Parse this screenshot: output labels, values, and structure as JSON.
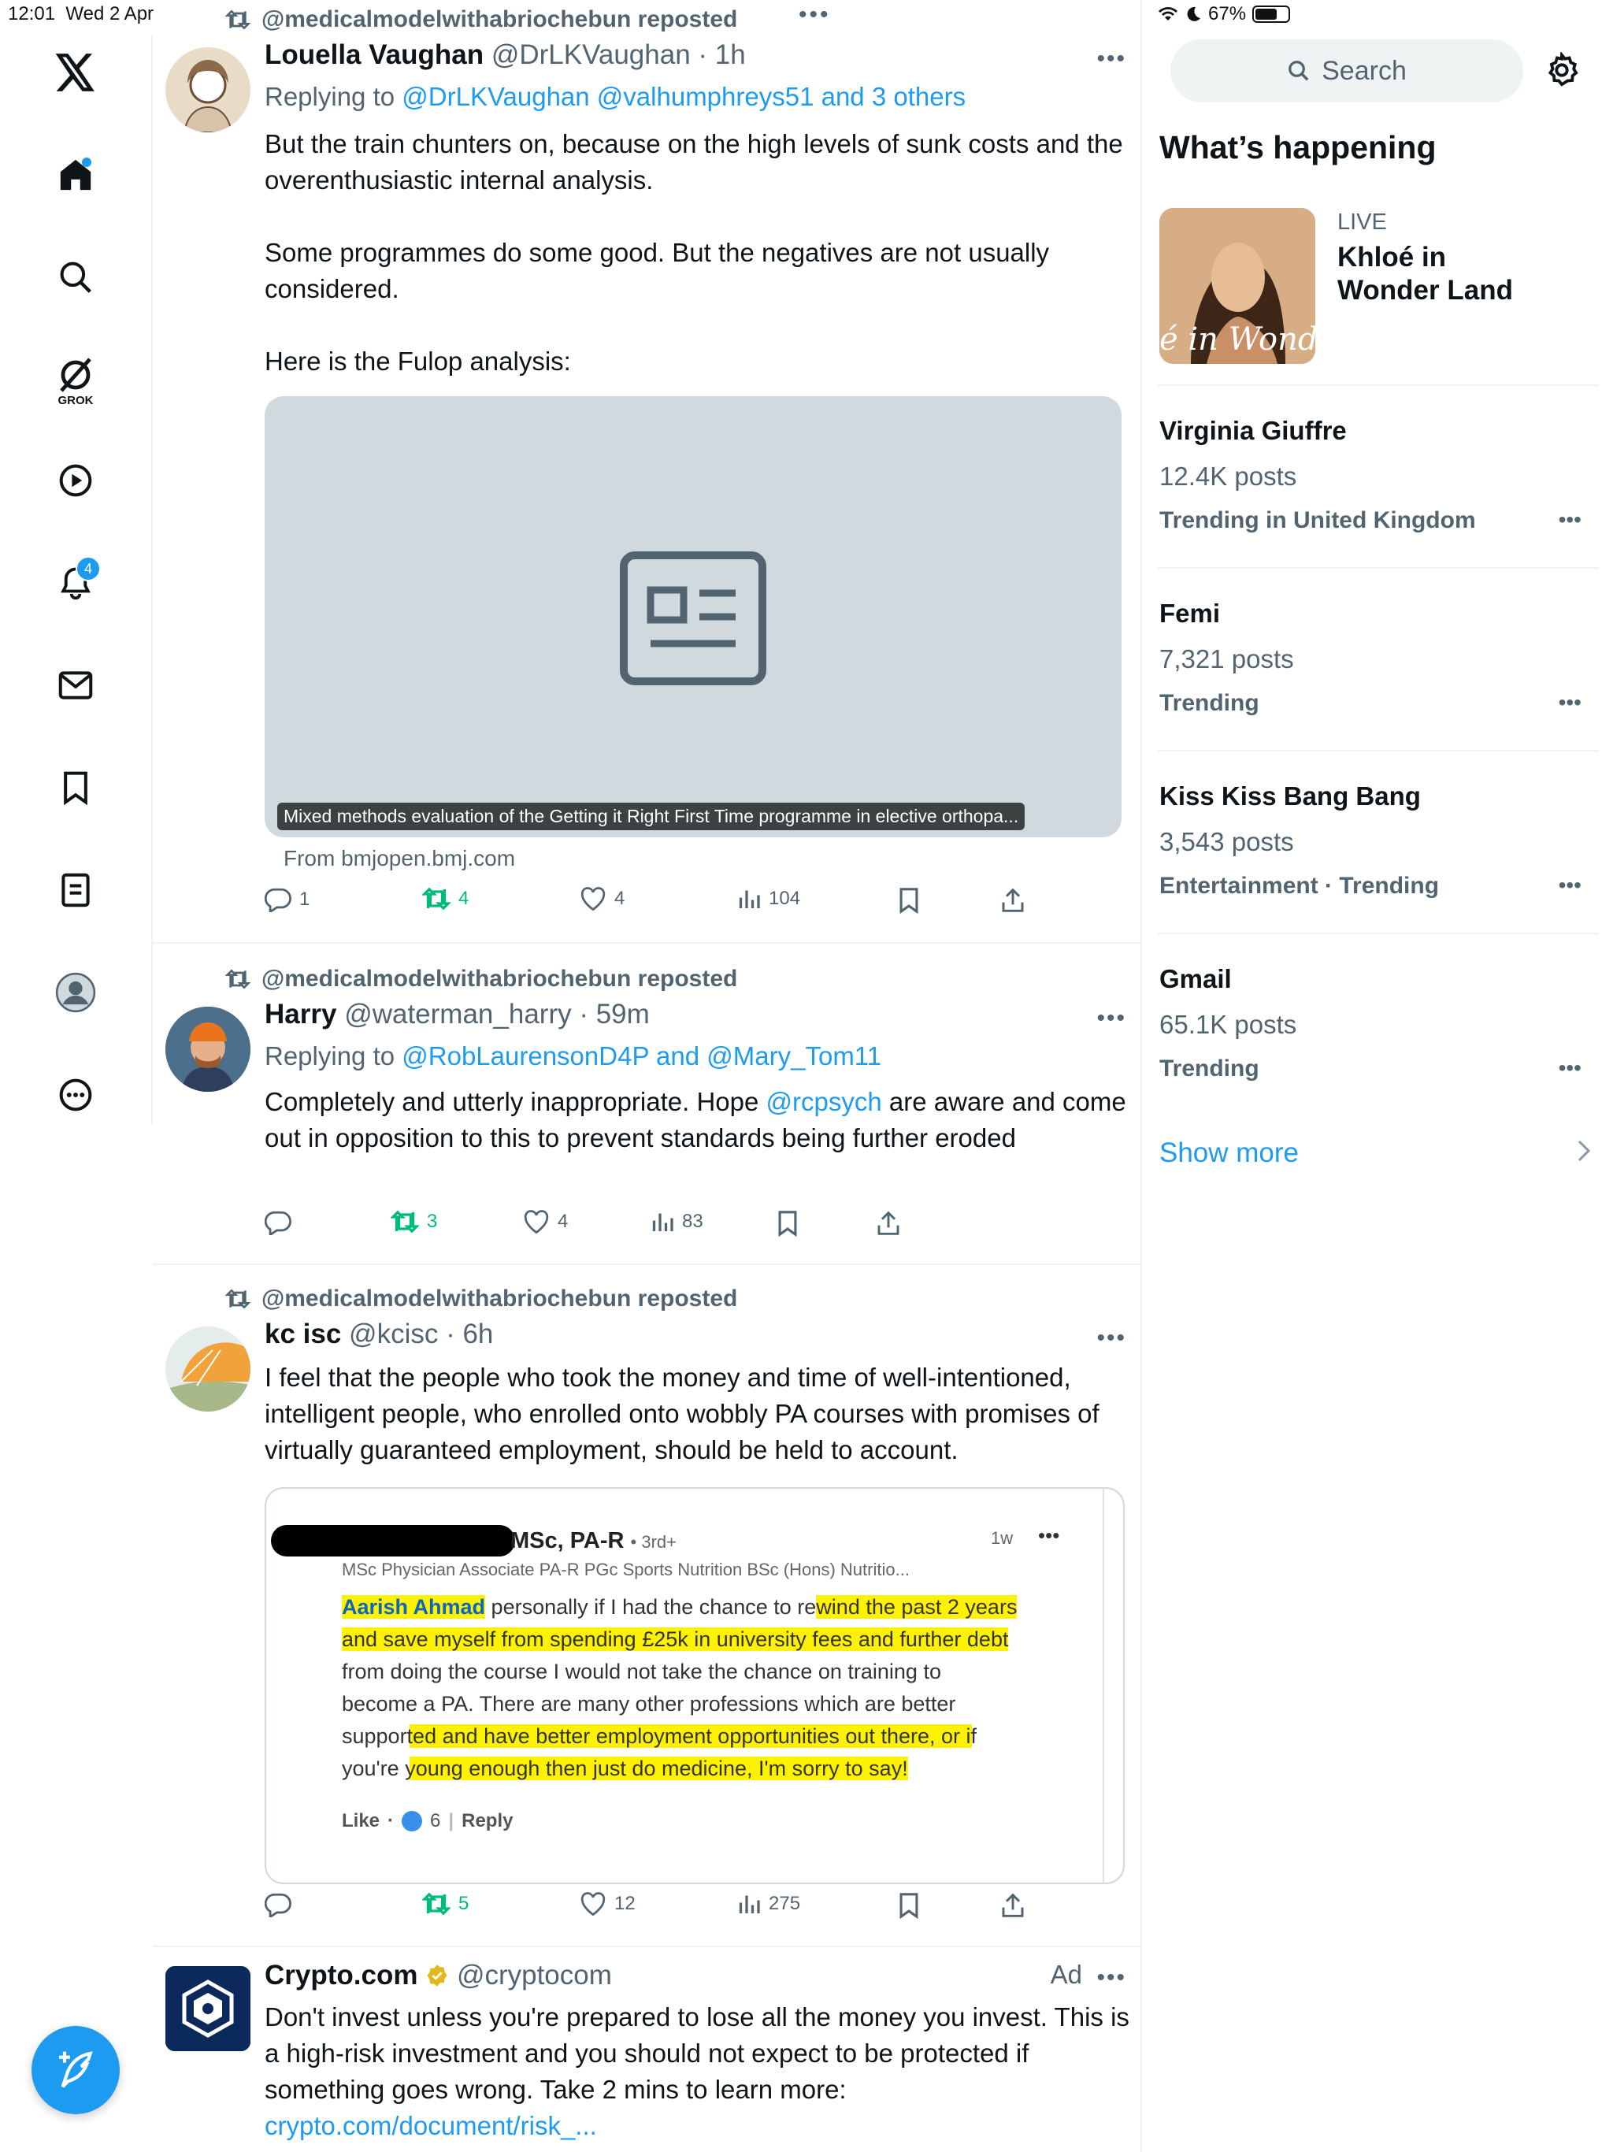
{
  "status_bar": {
    "time": "12:01",
    "date": "Wed 2 Apr",
    "battery": "67%",
    "battery_level": 0.67
  },
  "nav": {
    "notifications_badge": "4",
    "grok_label": "GROK",
    "items": [
      "x-logo-icon",
      "home-icon",
      "search-icon",
      "grok-icon",
      "play-icon",
      "bell-icon",
      "mail-icon",
      "bookmark-icon",
      "list-icon",
      "profile-icon",
      "more-icon"
    ]
  },
  "posts": [
    {
      "repost_label": "@medicalmodelwithabriochebun reposted",
      "name": "Louella Vaughan",
      "handle": "@DrLKVaughan",
      "time": "1h",
      "replying_prefix": "Replying to ",
      "replying_to": "@DrLKVaughan @valhumphreys51 and 3 others",
      "paragraphs": [
        "But the train chunters on, because on the high levels of sunk costs and the overenthusiastic internal analysis.",
        "Some programmes do some good. But the negatives are not usually considered.",
        "Here is the Fulop analysis:"
      ],
      "card_caption": "Mixed methods evaluation of the Getting it Right First Time programme in elective orthopa...",
      "card_source": "From bmjopen.bmj.com",
      "replies": "1",
      "reposts": "4",
      "likes": "4",
      "views": "104"
    },
    {
      "repost_label": "@medicalmodelwithabriochebun reposted",
      "name": "Harry",
      "handle": "@waterman_harry",
      "time": "59m",
      "replying_prefix": "Replying to ",
      "replying_to_a": "@RobLaurensonD4P",
      "replying_and": " and ",
      "replying_to_b": "@Mary_Tom11",
      "text_a": "Completely and utterly inappropriate. Hope ",
      "text_mention": "@rcpsych",
      "text_b": " are aware and come out in opposition to this to prevent standards being further eroded",
      "replies": "",
      "reposts": "3",
      "likes": "4",
      "views": "83"
    },
    {
      "repost_label": "@medicalmodelwithabriochebun reposted",
      "name": "kc isc",
      "handle": "@kcisc",
      "time": "6h",
      "text": "I feel that the people who took the money and time of well-intentioned, intelligent people, who enrolled onto wobbly PA courses with promises of virtually guaranteed employment, should be held to account.",
      "embed": {
        "name_suffix": "MSc, PA-R",
        "degree": "• 3rd+",
        "time": "1w",
        "headline": "MSc Physician Associate PA-R PGc Sports Nutrition BSc (Hons) Nutritio...",
        "mention": "Aarish Ahmad",
        "lines": [
          " personally if I had the chance to rewind the past 2 years",
          "and save myself from spending £25k in university fees and further debt",
          "from doing the course I would not take the chance on training to",
          "become a PA. There are many other professions which are better",
          "supported and have better employment opportunities out there, or if",
          "you're young enough then just do medicine, I'm sorry to say!"
        ],
        "like": "Like",
        "like_count": "6",
        "reply": "Reply"
      },
      "replies": "",
      "reposts": "5",
      "likes": "12",
      "views": "275"
    },
    {
      "name": "Crypto.com",
      "handle": "@cryptocom",
      "ad_label": "Ad",
      "text": "Don't invest unless you're prepared to lose all the money you invest. This is a high-risk investment and you should not expect to be protected if something goes wrong. Take 2 mins to learn more:",
      "link": "crypto.com/document/risk_..."
    }
  ],
  "sidebar": {
    "search_placeholder": "Search",
    "heading": "What’s happening",
    "live_label": "LIVE",
    "live_title": "Khloé in Wonder Land",
    "live_overlay": "é in Wonder L",
    "trends": [
      {
        "name": "Virginia Giuffre",
        "count": "12.4K posts",
        "context": "Trending in United Kingdom"
      },
      {
        "name": "Femi",
        "count": "7,321 posts",
        "context": "Trending"
      },
      {
        "name": "Kiss Kiss Bang Bang",
        "count": "3,543 posts",
        "context": "Entertainment · Trending"
      },
      {
        "name": "Gmail",
        "count": "65.1K posts",
        "context": "Trending"
      }
    ],
    "show_more": "Show more"
  },
  "colors": {
    "accent": "#1d9bf0",
    "repost_green": "#00ba7c",
    "muted": "#536471",
    "highlight": "#fff200"
  }
}
